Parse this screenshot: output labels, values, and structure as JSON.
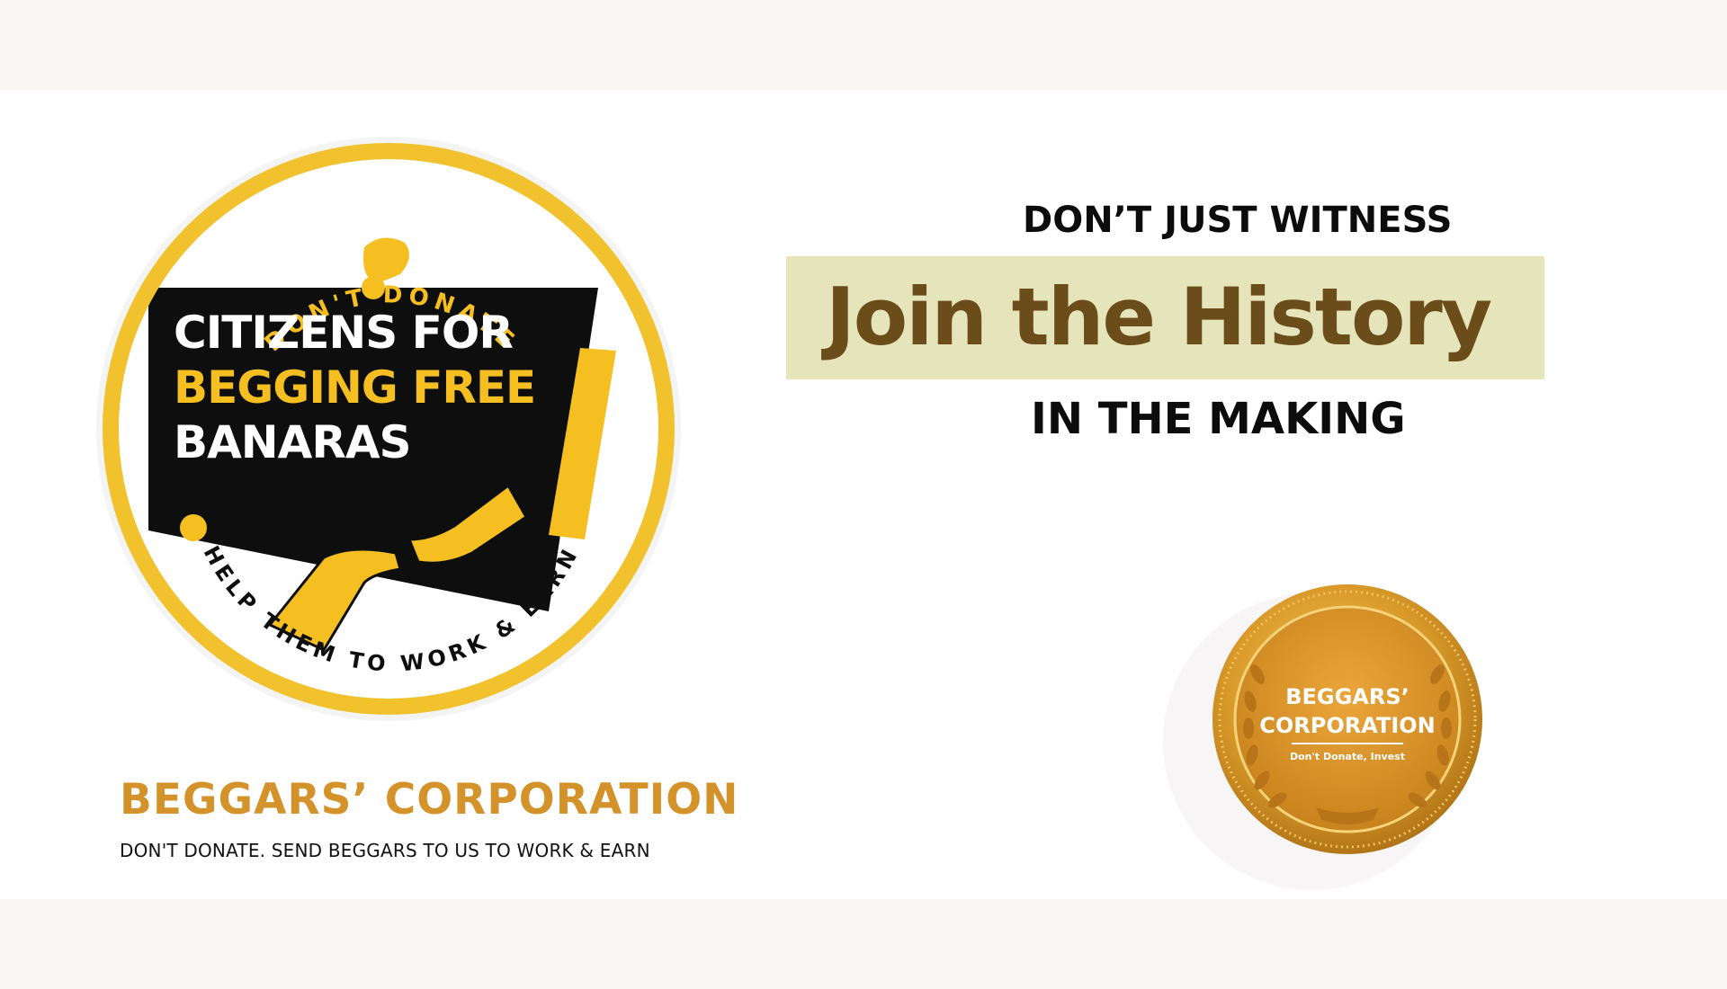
{
  "logo": {
    "arc_top": "DON'T DONATE",
    "line1": "CITIZENS FOR",
    "line2": "BEGGING FREE",
    "line3": "BANARAS",
    "arc_bottom": "HELP THEM TO WORK & EARN",
    "colors": {
      "ring": "#f2c12e",
      "black": "#0e0e0e",
      "yellow": "#f5bf22"
    }
  },
  "brand": {
    "title": "BEGGARS’ CORPORATION",
    "subtitle": "DON'T DONATE. SEND BEGGARS TO US TO WORK & EARN",
    "color": "#d4922a"
  },
  "headline": {
    "top": "DON’T JUST WITNESS",
    "main": "Join the History",
    "bottom": "IN THE MAKING",
    "highlight_color": "#e6e4bb",
    "main_color": "#6b4d1c"
  },
  "medal": {
    "line1": "BEGGARS’",
    "line2": "CORPORATION",
    "tagline": "Don't Donate, Invest",
    "color": "#d99a2a"
  }
}
